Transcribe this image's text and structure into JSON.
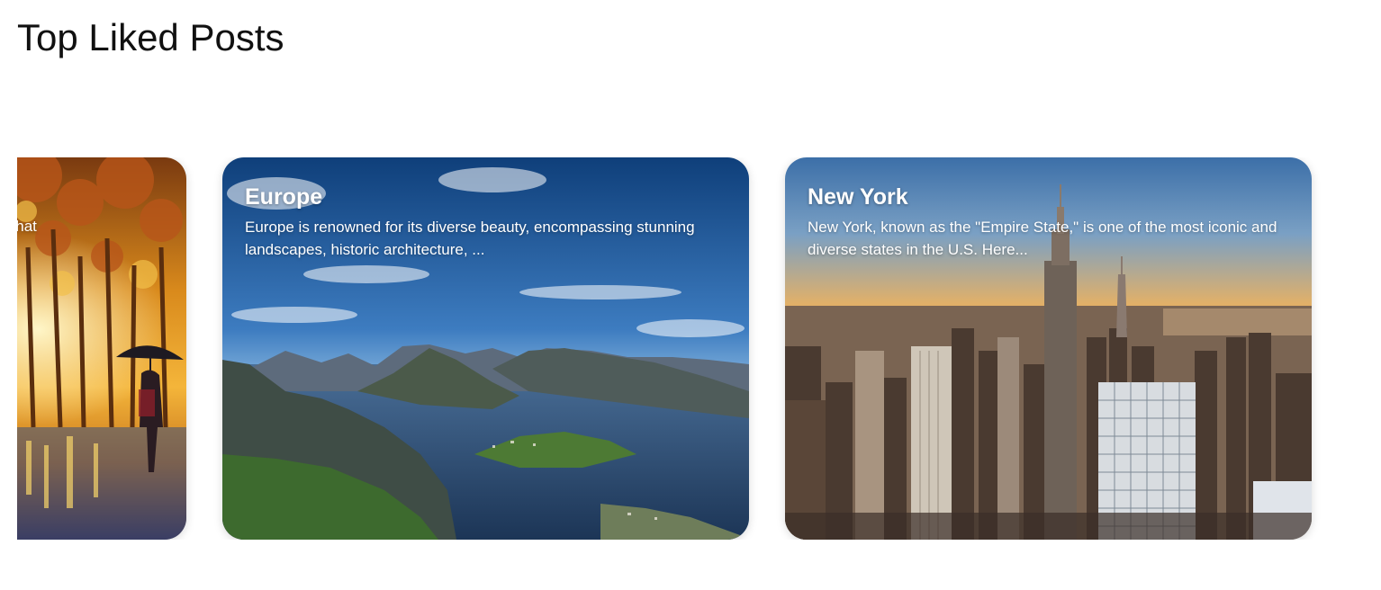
{
  "page": {
    "title": "Top Liked Posts"
  },
  "posts": [
    {
      "title": "",
      "description_visible": "an activities that",
      "image": "painting-rain-umbrella-woman"
    },
    {
      "title": "Europe",
      "description": "Europe is renowned for its diverse beauty, encompassing stunning landscapes, historic architecture, ...",
      "image": "mountain-fjord-landscape"
    },
    {
      "title": "New York",
      "description": "New York, known as the \"Empire State,\" is one of the most iconic and diverse states in the U.S. Here...",
      "image": "new-york-skyline-sunset"
    }
  ]
}
